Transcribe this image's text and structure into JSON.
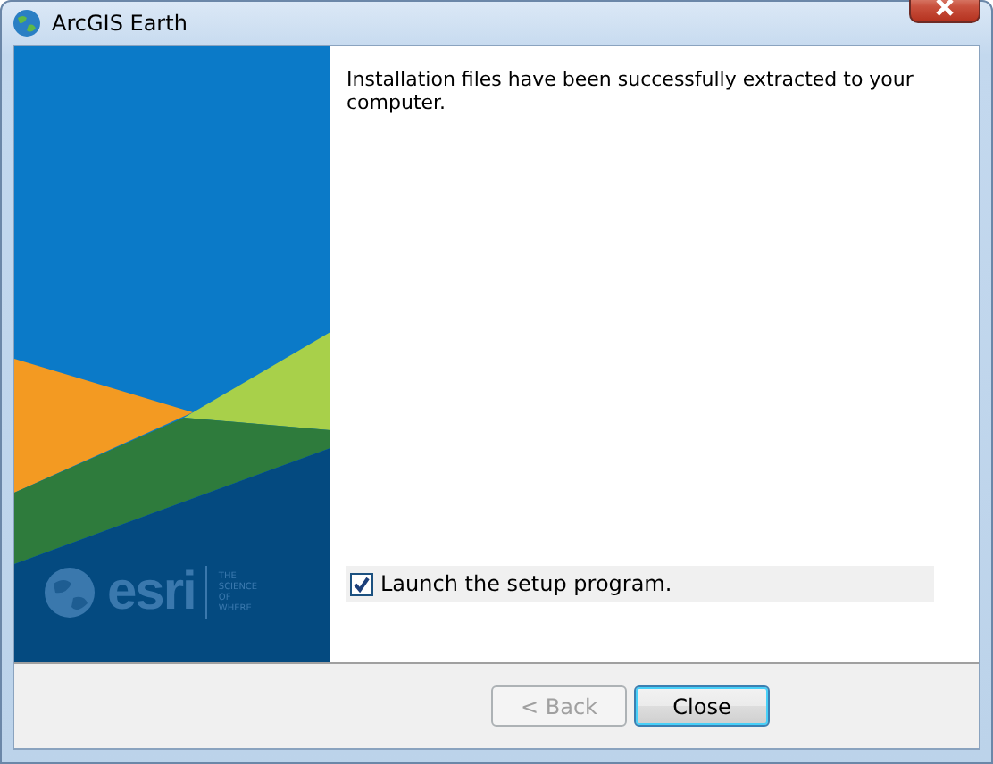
{
  "window": {
    "title": "ArcGIS Earth"
  },
  "banner": {
    "logo": "esri",
    "tagline": [
      "THE",
      "SCIENCE",
      "OF",
      "WHERE"
    ]
  },
  "message": "Installation files have been successfully extracted to your computer.",
  "launch_option": {
    "label": "Launch the setup program.",
    "checked": true
  },
  "buttons": [
    {
      "label": "< Back",
      "disabled": true
    },
    {
      "label": "Close",
      "disabled": false
    }
  ]
}
